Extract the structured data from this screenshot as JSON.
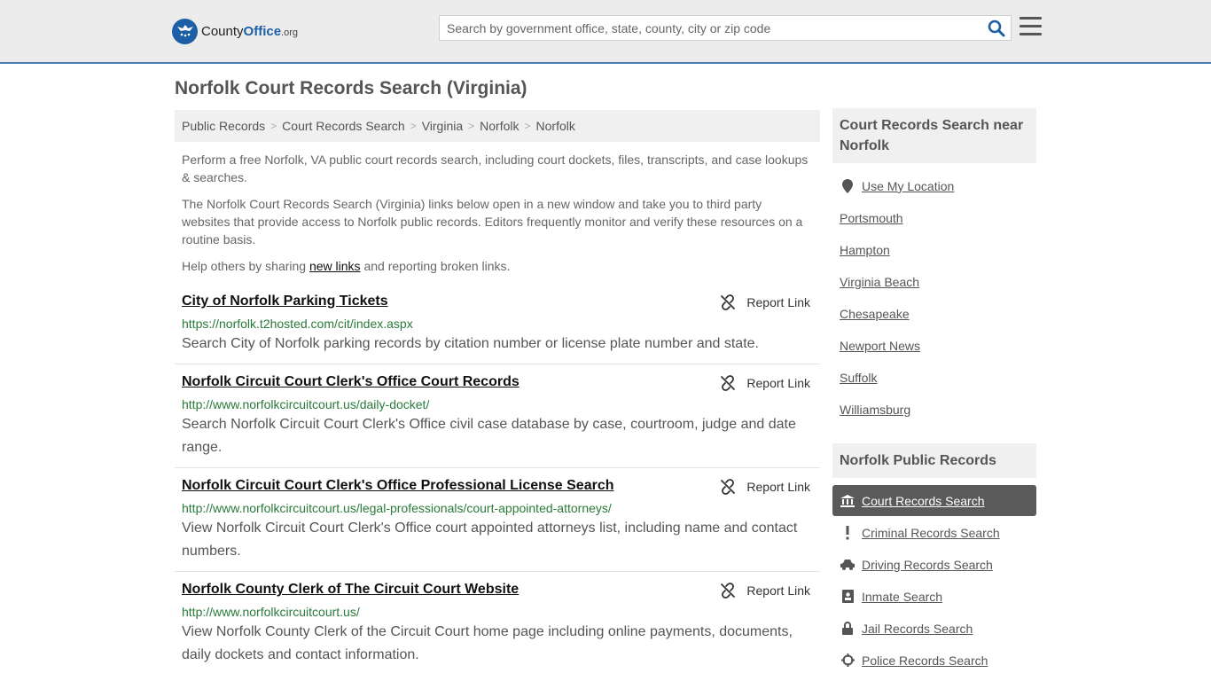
{
  "header": {
    "logo_main": "County",
    "logo_bold": "Office",
    "logo_org": ".org",
    "search_placeholder": "Search by government office, state, county, city or zip code"
  },
  "page": {
    "title": "Norfolk Court Records Search (Virginia)"
  },
  "breadcrumb": [
    "Public Records",
    "Court Records Search",
    "Virginia",
    "Norfolk",
    "Norfolk"
  ],
  "intro": {
    "p1": "Perform a free Norfolk, VA public court records search, including court dockets, files, transcripts, and case lookups & searches.",
    "p2": "The Norfolk Court Records Search (Virginia) links below open in a new window and take you to third party websites that provide access to Norfolk public records. Editors frequently monitor and verify these resources on a routine basis.",
    "p3_before": "Help others by sharing ",
    "p3_link": "new links",
    "p3_after": " and reporting broken links."
  },
  "report_label": "Report Link",
  "results": [
    {
      "title": "City of Norfolk Parking Tickets",
      "url": "https://norfolk.t2hosted.com/cit/index.aspx",
      "desc": "Search City of Norfolk parking records by citation number or license plate number and state."
    },
    {
      "title": "Norfolk Circuit Court Clerk's Office Court Records",
      "url": "http://www.norfolkcircuitcourt.us/daily-docket/",
      "desc": "Search Norfolk Circuit Court Clerk's Office civil case database by case, courtroom, judge and date range."
    },
    {
      "title": "Norfolk Circuit Court Clerk's Office Professional License Search",
      "url": "http://www.norfolkcircuitcourt.us/legal-professionals/court-appointed-attorneys/",
      "desc": "View Norfolk Circuit Court Clerk's Office court appointed attorneys list, including name and contact numbers."
    },
    {
      "title": "Norfolk County Clerk of The Circuit Court Website",
      "url": "http://www.norfolkcircuitcourt.us/",
      "desc": "View Norfolk County Clerk of the Circuit Court home page including online payments, documents, daily dockets and contact information."
    }
  ],
  "sidebar": {
    "near_title": "Court Records Search near Norfolk",
    "use_location": "Use My Location",
    "near_links": [
      "Portsmouth",
      "Hampton",
      "Virginia Beach",
      "Chesapeake",
      "Newport News",
      "Suffolk",
      "Williamsburg"
    ],
    "public_title": "Norfolk Public Records",
    "public_links": [
      {
        "label": "Court Records Search",
        "icon": "courthouse-icon"
      },
      {
        "label": "Criminal Records Search",
        "icon": "exclamation-icon"
      },
      {
        "label": "Driving Records Search",
        "icon": "car-icon"
      },
      {
        "label": "Inmate Search",
        "icon": "id-card-icon"
      },
      {
        "label": "Jail Records Search",
        "icon": "lock-icon"
      },
      {
        "label": "Police Records Search",
        "icon": "crosshair-icon"
      }
    ]
  },
  "colors": {
    "accent": "#1d5fa6",
    "url_green": "#2a7a3a",
    "active_bg": "#5a5a5a"
  }
}
